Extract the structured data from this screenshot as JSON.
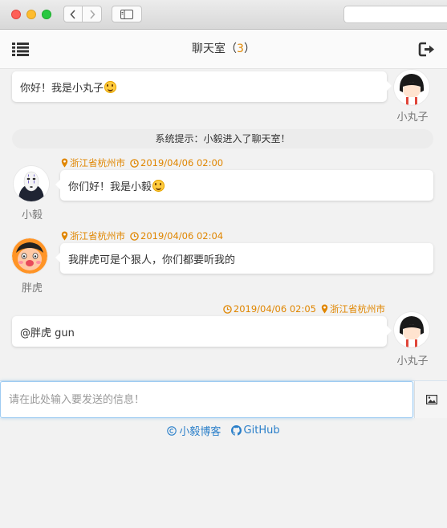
{
  "header": {
    "title": "聊天室",
    "count_open": "（",
    "count": "3",
    "count_close": "）"
  },
  "messages": [
    {
      "sender": "小丸子",
      "text": "你好！我是小丸子"
    },
    {
      "system": "系统提示：小毅进入了聊天室！"
    },
    {
      "sender": "小毅",
      "location": "浙江省杭州市",
      "time": "2019/04/06 02:00",
      "text": "你们好！我是小毅"
    },
    {
      "sender": "胖虎",
      "location": "浙江省杭州市",
      "time": "2019/04/06 02:04",
      "text": "我胖虎可是个狠人，你们都要听我的"
    },
    {
      "sender": "小丸子",
      "location": "浙江省杭州市",
      "time": "2019/04/06 02:05",
      "text": "@胖虎 gun"
    }
  ],
  "input": {
    "placeholder": "请在此处输入要发送的信息！"
  },
  "footer": {
    "blog": "小毅博客",
    "github": "GitHub"
  },
  "colors": {
    "accent": "#e08600",
    "link": "#2a7fc9"
  },
  "icons": [
    "menu-icon",
    "exit-icon",
    "location-icon",
    "clock-icon",
    "image-icon",
    "copyright-icon",
    "github-icon"
  ]
}
